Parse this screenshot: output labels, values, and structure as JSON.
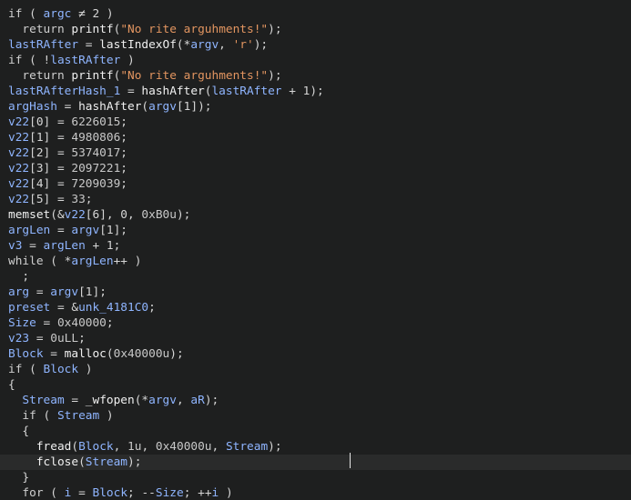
{
  "colors": {
    "background": "#1e1f1f",
    "current_line": "#2a2b2b",
    "plain": "#d6d6d6",
    "keyword": "#cfcfcf",
    "variable": "#8fb5ff",
    "function": "#f0f0f0",
    "string": "#e29560",
    "number": "#c8c8c8",
    "caret": "#e6e6e6"
  },
  "code": {
    "current_line_index": 29,
    "lines": [
      [
        [
          "kw",
          "if"
        ],
        [
          "plain",
          " ( "
        ],
        [
          "var",
          "argc"
        ],
        [
          "plain",
          " ≠ 2 )"
        ]
      ],
      [
        [
          "plain",
          "  "
        ],
        [
          "kw",
          "return"
        ],
        [
          "plain",
          " "
        ],
        [
          "fn",
          "printf"
        ],
        [
          "plain",
          "("
        ],
        [
          "str",
          "\"No rite arguhments!\""
        ],
        [
          "plain",
          ");"
        ]
      ],
      [
        [
          "var",
          "lastRAfter"
        ],
        [
          "plain",
          " = "
        ],
        [
          "fn",
          "lastIndexOf"
        ],
        [
          "plain",
          "(*"
        ],
        [
          "var",
          "argv"
        ],
        [
          "plain",
          ", "
        ],
        [
          "str",
          "'r'"
        ],
        [
          "plain",
          ");"
        ]
      ],
      [
        [
          "kw",
          "if"
        ],
        [
          "plain",
          " ( !"
        ],
        [
          "var",
          "lastRAfter"
        ],
        [
          "plain",
          " )"
        ]
      ],
      [
        [
          "plain",
          "  "
        ],
        [
          "kw",
          "return"
        ],
        [
          "plain",
          " "
        ],
        [
          "fn",
          "printf"
        ],
        [
          "plain",
          "("
        ],
        [
          "str",
          "\"No rite arguhments!\""
        ],
        [
          "plain",
          ");"
        ]
      ],
      [
        [
          "var",
          "lastRAfterHash_1"
        ],
        [
          "plain",
          " = "
        ],
        [
          "fn",
          "hashAfter"
        ],
        [
          "plain",
          "("
        ],
        [
          "var",
          "lastRAfter"
        ],
        [
          "plain",
          " + 1);"
        ]
      ],
      [
        [
          "var",
          "argHash"
        ],
        [
          "plain",
          " = "
        ],
        [
          "fn",
          "hashAfter"
        ],
        [
          "plain",
          "("
        ],
        [
          "var",
          "argv"
        ],
        [
          "plain",
          "[1]);"
        ]
      ],
      [
        [
          "var",
          "v22"
        ],
        [
          "plain",
          "[0] = "
        ],
        [
          "num",
          "6226015"
        ],
        [
          "plain",
          ";"
        ]
      ],
      [
        [
          "var",
          "v22"
        ],
        [
          "plain",
          "[1] = "
        ],
        [
          "num",
          "4980806"
        ],
        [
          "plain",
          ";"
        ]
      ],
      [
        [
          "var",
          "v22"
        ],
        [
          "plain",
          "[2] = "
        ],
        [
          "num",
          "5374017"
        ],
        [
          "plain",
          ";"
        ]
      ],
      [
        [
          "var",
          "v22"
        ],
        [
          "plain",
          "[3] = "
        ],
        [
          "num",
          "2097221"
        ],
        [
          "plain",
          ";"
        ]
      ],
      [
        [
          "var",
          "v22"
        ],
        [
          "plain",
          "[4] = "
        ],
        [
          "num",
          "7209039"
        ],
        [
          "plain",
          ";"
        ]
      ],
      [
        [
          "var",
          "v22"
        ],
        [
          "plain",
          "[5] = "
        ],
        [
          "num",
          "33"
        ],
        [
          "plain",
          ";"
        ]
      ],
      [
        [
          "fn",
          "memset"
        ],
        [
          "plain",
          "(&"
        ],
        [
          "var",
          "v22"
        ],
        [
          "plain",
          "[6], 0, "
        ],
        [
          "num",
          "0xB0u"
        ],
        [
          "plain",
          ");"
        ]
      ],
      [
        [
          "var",
          "argLen"
        ],
        [
          "plain",
          " = "
        ],
        [
          "var",
          "argv"
        ],
        [
          "plain",
          "[1];"
        ]
      ],
      [
        [
          "var",
          "v3"
        ],
        [
          "plain",
          " = "
        ],
        [
          "var",
          "argLen"
        ],
        [
          "plain",
          " + 1;"
        ]
      ],
      [
        [
          "kw",
          "while"
        ],
        [
          "plain",
          " ( *"
        ],
        [
          "var",
          "argLen"
        ],
        [
          "plain",
          "++ )"
        ]
      ],
      [
        [
          "plain",
          "  ;"
        ]
      ],
      [
        [
          "var",
          "arg"
        ],
        [
          "plain",
          " = "
        ],
        [
          "var",
          "argv"
        ],
        [
          "plain",
          "[1];"
        ]
      ],
      [
        [
          "var",
          "preset"
        ],
        [
          "plain",
          " = &"
        ],
        [
          "var",
          "unk_4181C0"
        ],
        [
          "plain",
          ";"
        ]
      ],
      [
        [
          "var",
          "Size"
        ],
        [
          "plain",
          " = "
        ],
        [
          "num",
          "0x40000"
        ],
        [
          "plain",
          ";"
        ]
      ],
      [
        [
          "var",
          "v23"
        ],
        [
          "plain",
          " = "
        ],
        [
          "num",
          "0uLL"
        ],
        [
          "plain",
          ";"
        ]
      ],
      [
        [
          "var",
          "Block"
        ],
        [
          "plain",
          " = "
        ],
        [
          "fn",
          "malloc"
        ],
        [
          "plain",
          "("
        ],
        [
          "num",
          "0x40000u"
        ],
        [
          "plain",
          ");"
        ]
      ],
      [
        [
          "kw",
          "if"
        ],
        [
          "plain",
          " ( "
        ],
        [
          "var",
          "Block"
        ],
        [
          "plain",
          " )"
        ]
      ],
      [
        [
          "plain",
          "{"
        ]
      ],
      [
        [
          "plain",
          "  "
        ],
        [
          "var",
          "Stream"
        ],
        [
          "plain",
          " = "
        ],
        [
          "fn",
          "_wfopen"
        ],
        [
          "plain",
          "(*"
        ],
        [
          "var",
          "argv"
        ],
        [
          "plain",
          ", "
        ],
        [
          "var",
          "aR"
        ],
        [
          "plain",
          ");"
        ]
      ],
      [
        [
          "plain",
          "  "
        ],
        [
          "kw",
          "if"
        ],
        [
          "plain",
          " ( "
        ],
        [
          "var",
          "Stream"
        ],
        [
          "plain",
          " )"
        ]
      ],
      [
        [
          "plain",
          "  {"
        ]
      ],
      [
        [
          "plain",
          "    "
        ],
        [
          "fn",
          "fread"
        ],
        [
          "plain",
          "("
        ],
        [
          "var",
          "Block"
        ],
        [
          "plain",
          ", "
        ],
        [
          "num",
          "1u"
        ],
        [
          "plain",
          ", "
        ],
        [
          "num",
          "0x40000u"
        ],
        [
          "plain",
          ", "
        ],
        [
          "var",
          "Stream"
        ],
        [
          "plain",
          ");"
        ]
      ],
      [
        [
          "plain",
          "    "
        ],
        [
          "fn",
          "fclose"
        ],
        [
          "plain",
          "("
        ],
        [
          "var",
          "Stream"
        ],
        [
          "plain",
          ");"
        ]
      ],
      [
        [
          "plain",
          "  }"
        ]
      ],
      [
        [
          "plain",
          "  "
        ],
        [
          "kw",
          "for"
        ],
        [
          "plain",
          " ( "
        ],
        [
          "var",
          "i"
        ],
        [
          "plain",
          " = "
        ],
        [
          "var",
          "Block"
        ],
        [
          "plain",
          "; --"
        ],
        [
          "var",
          "Size"
        ],
        [
          "plain",
          "; ++"
        ],
        [
          "var",
          "i"
        ],
        [
          "plain",
          " )"
        ]
      ]
    ]
  }
}
